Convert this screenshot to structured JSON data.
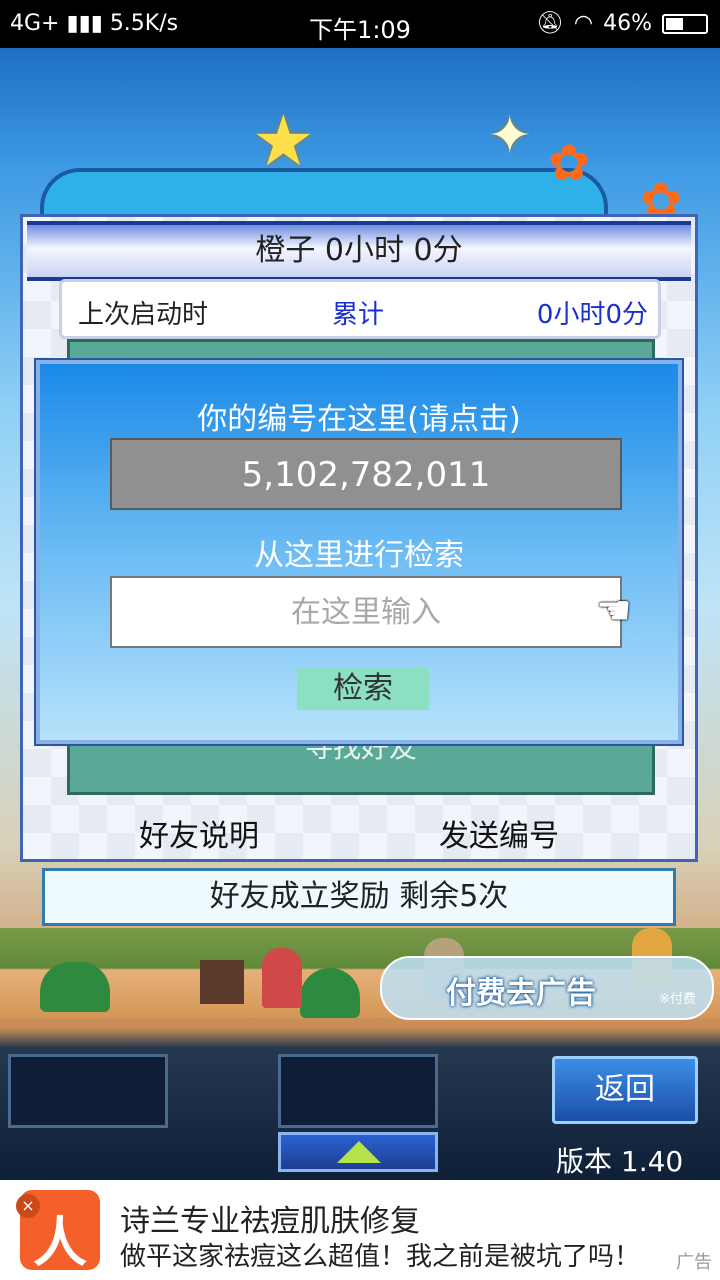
{
  "status_bar": {
    "network": "4G+",
    "speed": "5.5K/s",
    "time": "下午1:09",
    "battery": "46%",
    "battery_level": 0.46
  },
  "dialog": {
    "title": "橙子  0小时 0分",
    "stats": {
      "label": "上次启动时",
      "cumulative_label": "累计",
      "cumulative_value": "0小时0分"
    },
    "hidden_button_label": "寻找好友",
    "friend_help_label": "好友说明",
    "send_id_label": "发送编号"
  },
  "popup": {
    "your_id_label": "你的编号在这里(请点击)",
    "your_id_value": "5,102,782,011",
    "search_label": "从这里进行检索",
    "search_placeholder": "在这里输入",
    "search_button": "检索"
  },
  "reward_bar": "好友成立奖励  剩余5次",
  "remove_ads": {
    "label": "付费去广告",
    "note": "※付费"
  },
  "bottom": {
    "back_button": "返回",
    "version": "版本 1.40"
  },
  "ad": {
    "title": "诗兰专业祛痘肌肤修复",
    "description": "做平这家祛痘这么超值！我之前是被坑了吗！",
    "tag": "广告"
  }
}
